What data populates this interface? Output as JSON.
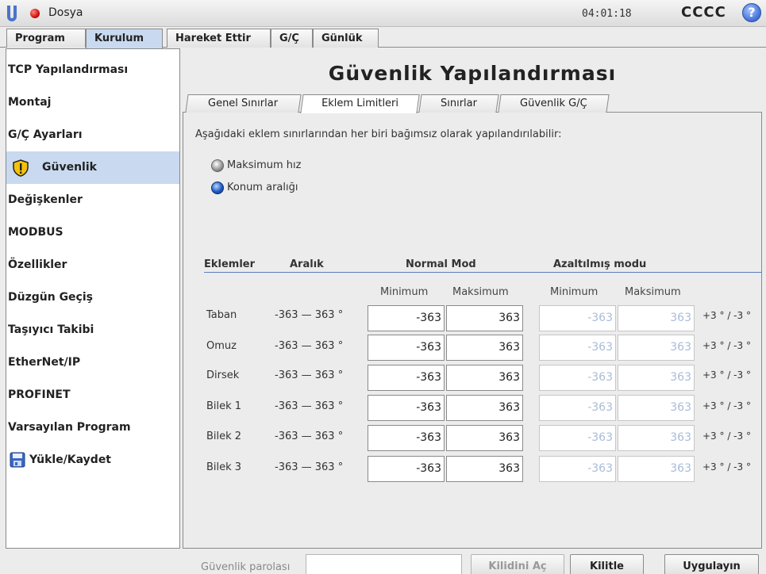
{
  "header": {
    "menu_label": "Dosya",
    "clock": "04:01:18",
    "robot_name": "CCCC",
    "help_glyph": "?"
  },
  "main_tabs": [
    "Program",
    "Kurulum",
    "Hareket Ettir",
    "G/Ç",
    "Günlük"
  ],
  "sidebar": {
    "items": [
      "TCP Yapılandırması",
      "Montaj",
      "G/Ç Ayarları",
      "Güvenlik",
      "Değişkenler",
      "MODBUS",
      "Özellikler",
      "Düzgün Geçiş",
      "Taşıyıcı Takibi",
      "EtherNet/IP",
      "PROFINET",
      "Varsayılan Program",
      "Yükle/Kaydet"
    ]
  },
  "page": {
    "title": "Güvenlik Yapılandırması",
    "sub_tabs": [
      "Genel Sınırlar",
      "Eklem Limitleri",
      "Sınırlar",
      "Güvenlik G/Ç"
    ],
    "description": "Aşağıdaki eklem sınırlarından her biri bağımsız olarak yapılandırılabilir:",
    "radio_options": [
      "Maksimum hız",
      "Konum aralığı"
    ],
    "selected_option": "Konum aralığı",
    "columns": {
      "joints": "Eklemler",
      "range": "Aralık",
      "normal": "Normal Mod",
      "reduced": "Azaltılmış modu",
      "min": "Minimum",
      "max": "Maksimum"
    },
    "rows": [
      {
        "joint": "Taban",
        "range": "-363 — 363 °",
        "normal_min": "-363",
        "normal_max": "363",
        "reduced_min": "-363",
        "reduced_max": "363",
        "tolerance": "+3 ° / -3 °"
      },
      {
        "joint": "Omuz",
        "range": "-363 — 363 °",
        "normal_min": "-363",
        "normal_max": "363",
        "reduced_min": "-363",
        "reduced_max": "363",
        "tolerance": "+3 ° / -3 °"
      },
      {
        "joint": "Dirsek",
        "range": "-363 — 363 °",
        "normal_min": "-363",
        "normal_max": "363",
        "reduced_min": "-363",
        "reduced_max": "363",
        "tolerance": "+3 ° / -3 °"
      },
      {
        "joint": "Bilek 1",
        "range": "-363 — 363 °",
        "normal_min": "-363",
        "normal_max": "363",
        "reduced_min": "-363",
        "reduced_max": "363",
        "tolerance": "+3 ° / -3 °"
      },
      {
        "joint": "Bilek 2",
        "range": "-363 — 363 °",
        "normal_min": "-363",
        "normal_max": "363",
        "reduced_min": "-363",
        "reduced_max": "363",
        "tolerance": "+3 ° / -3 °"
      },
      {
        "joint": "Bilek 3",
        "range": "-363 — 363 °",
        "normal_min": "-363",
        "normal_max": "363",
        "reduced_min": "-363",
        "reduced_max": "363",
        "tolerance": "+3 ° / -3 °"
      }
    ]
  },
  "footer": {
    "password_label": "Güvenlik parolası",
    "password_value": "",
    "unlock_label": "Kilidini Aç",
    "lock_label": "Kilitle",
    "apply_label": "Uygulayın"
  },
  "colors": {
    "selected_bg": "#c9daf0",
    "disabled_text": "#a9bcd8",
    "status_red": "#d01010",
    "radio_blue": "#1f5bc6"
  }
}
